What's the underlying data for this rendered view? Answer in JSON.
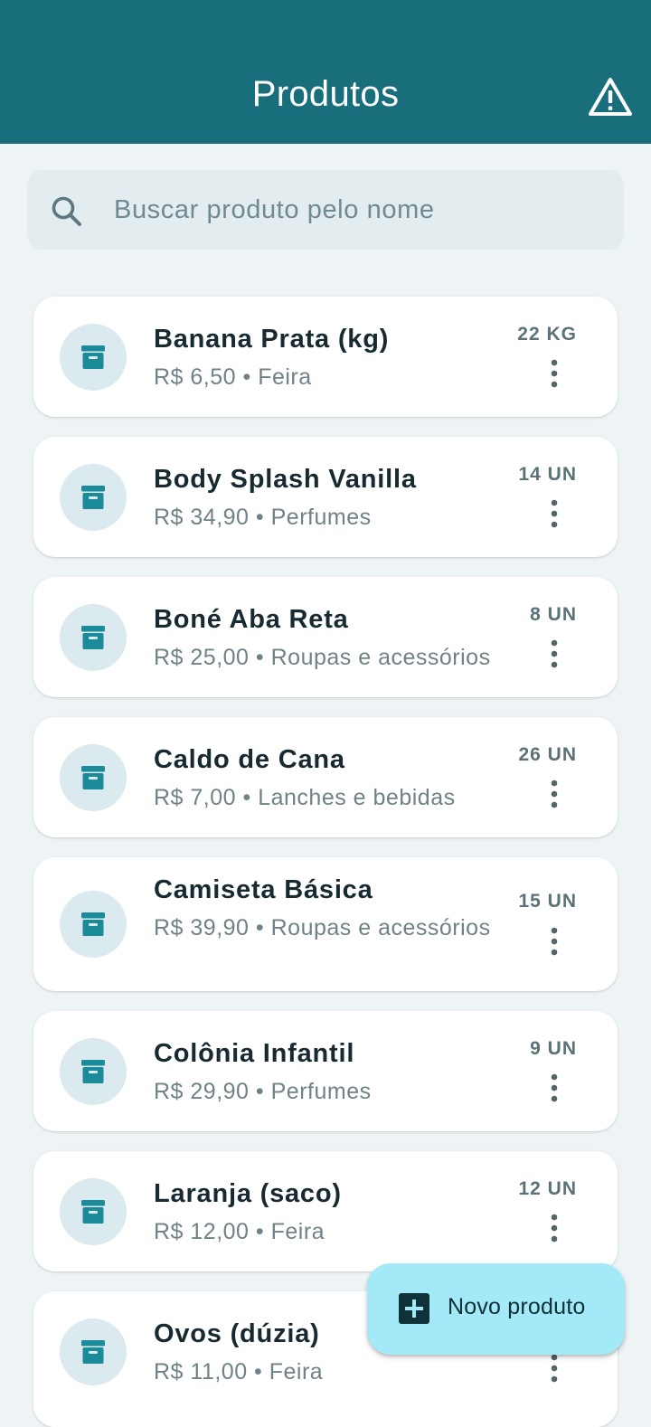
{
  "header": {
    "title": "Produtos",
    "action_icon": "warning-icon"
  },
  "search": {
    "placeholder": "Buscar produto pelo nome",
    "value": ""
  },
  "colors": {
    "app_bar": "#186e7b",
    "fab": "#a3e9f7",
    "accent": "#1b8b9a"
  },
  "products": [
    {
      "name": "Banana Prata (kg)",
      "price": "R$ 6,50",
      "category": "Feira",
      "subtitle": "R$ 6,50 • Feira",
      "quantity": "22 KG"
    },
    {
      "name": "Body Splash Vanilla",
      "price": "R$ 34,90",
      "category": "Perfumes",
      "subtitle": "R$ 34,90 • Perfumes",
      "quantity": "14 UN"
    },
    {
      "name": "Boné Aba Reta",
      "price": "R$ 25,00",
      "category": "Roupas e acessórios",
      "subtitle": "R$ 25,00 • Roupas e acessórios",
      "quantity": "8 UN"
    },
    {
      "name": "Caldo de Cana",
      "price": "R$ 7,00",
      "category": "Lanches e bebidas",
      "subtitle": "R$ 7,00 • Lanches e bebidas",
      "quantity": "26 UN"
    },
    {
      "name": "Camiseta Básica",
      "price": "R$ 39,90",
      "category": "Roupas e acessórios",
      "subtitle": "R$ 39,90 • Roupas e acessórios",
      "quantity": "15 UN"
    },
    {
      "name": "Colônia Infantil",
      "price": "R$ 29,90",
      "category": "Perfumes",
      "subtitle": "R$ 29,90 • Perfumes",
      "quantity": "9 UN"
    },
    {
      "name": "Laranja (saco)",
      "price": "R$ 12,00",
      "category": "Feira",
      "subtitle": "R$ 12,00 • Feira",
      "quantity": "12 UN"
    },
    {
      "name": "Ovos (dúzia)",
      "price": "R$ 11,00",
      "category": "Feira",
      "subtitle": "R$ 11,00 • Feira",
      "quantity": ""
    }
  ],
  "fab": {
    "label": "Novo produto",
    "icon": "add-box-icon"
  }
}
